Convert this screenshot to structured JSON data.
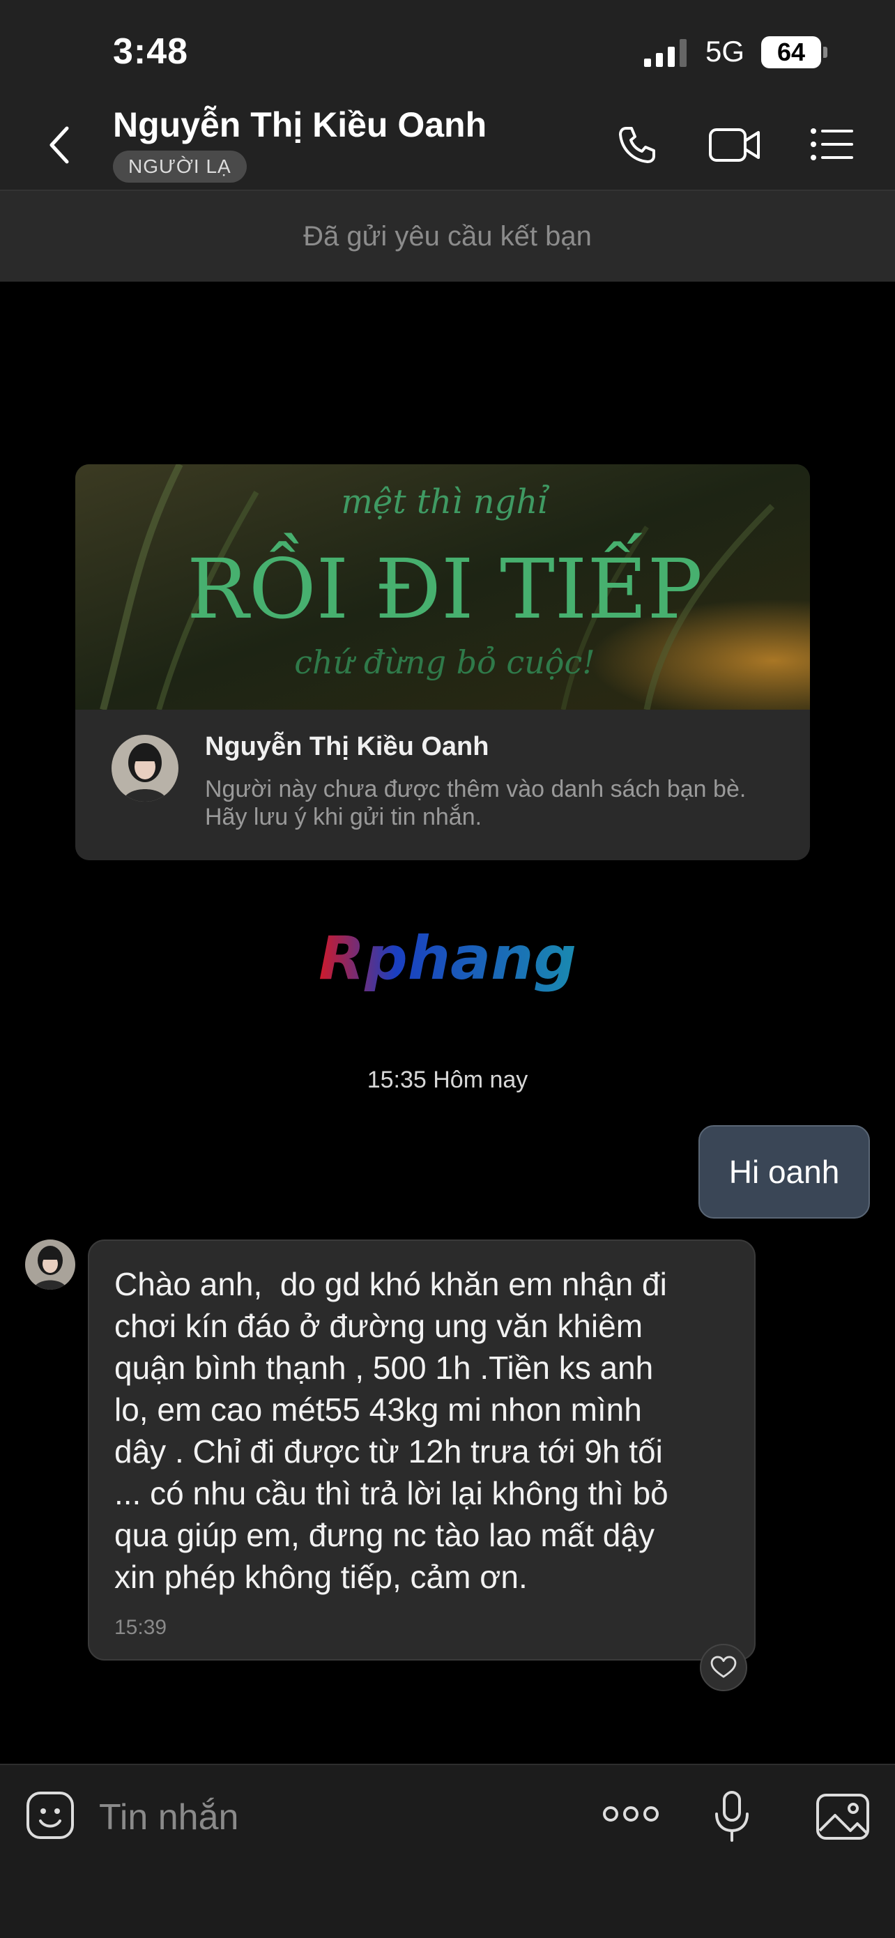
{
  "status_bar": {
    "time": "3:48",
    "network": "5G",
    "battery": "64",
    "signal_icon": "cellular-signal-icon",
    "battery_icon": "battery-icon"
  },
  "header": {
    "contact_name": "Nguyễn Thị Kiều Oanh",
    "badge": "NGƯỜI LẠ",
    "back_icon": "chevron-left-icon",
    "call_icon": "phone-icon",
    "video_icon": "video-camera-icon",
    "menu_icon": "list-menu-icon"
  },
  "friend_request": {
    "text": "Đã gửi yêu cầu kết bạn"
  },
  "profile_card": {
    "cover_line1": "mệt thì nghỉ",
    "cover_line2": "RỒI ĐI TIẾP",
    "cover_line3": "chứ đừng bỏ cuộc!",
    "name": "Nguyễn Thị Kiều Oanh",
    "note": "Người này chưa được thêm vào danh sách bạn bè. Hãy lưu ý khi gửi tin nhắn."
  },
  "watermark": {
    "text": "Rphang"
  },
  "conversation": {
    "timestamp": "15:35 Hôm nay",
    "outgoing": {
      "text": "Hi oanh"
    },
    "incoming": {
      "text": "Chào anh,  do gd khó khăn em nhận đi\nchơi kín đáo ở đường ung văn khiêm\nquận bình thạnh , 500 1h .Tiền ks anh\nlo, em cao mét55 43kg mi nhon mình\ndây . Chỉ đi được từ 12h trưa tới 9h tối\n... có nhu cầu thì trả lời lại không thì bỏ\nqua giúp em, đưng nc tào lao mất dậy\nxin phép không tiếp, cảm ơn.",
      "time": "15:39",
      "reaction_icon": "heart-icon"
    }
  },
  "composer": {
    "placeholder": "Tin nhắn",
    "sticker_icon": "sticker-icon",
    "more_icon": "more-dots-icon",
    "mic_icon": "microphone-icon",
    "gallery_icon": "gallery-icon"
  },
  "colors": {
    "header_bg": "#222222",
    "outgoing_bubble": "#3a4656",
    "incoming_bubble": "#2b2b2b"
  }
}
